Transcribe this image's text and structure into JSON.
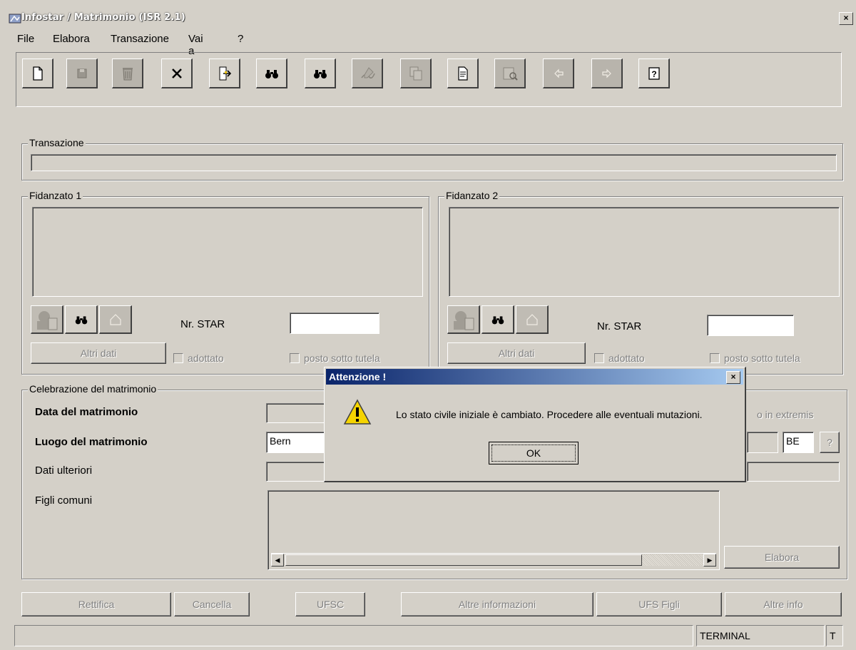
{
  "window": {
    "title": "Infostar / Matrimonio (ISR 2.1)",
    "close_glyph": "×"
  },
  "menu": [
    "File",
    "Elabora",
    "Transazione",
    "Vai a",
    "?"
  ],
  "toolbar": {
    "buttons": [
      {
        "icon": "new-document-icon",
        "enabled": true
      },
      {
        "icon": "save-icon",
        "enabled": false
      },
      {
        "icon": "trash-icon",
        "enabled": false
      },
      {
        "icon": "close-icon",
        "enabled": true
      },
      {
        "icon": "exit-door-icon",
        "enabled": true
      },
      {
        "icon": "binoculars-icon",
        "enabled": true
      },
      {
        "icon": "binoculars-icon",
        "enabled": true
      },
      {
        "icon": "sign-icon",
        "enabled": false
      },
      {
        "icon": "copy-icon",
        "enabled": false
      },
      {
        "icon": "document-icon",
        "enabled": true
      },
      {
        "icon": "preview-icon",
        "enabled": false
      },
      {
        "icon": "arrow-left-icon",
        "enabled": false
      },
      {
        "icon": "arrow-right-icon",
        "enabled": false
      },
      {
        "icon": "help-icon",
        "enabled": true
      }
    ]
  },
  "transazione": {
    "label": "Transazione",
    "value": ""
  },
  "fidanzato1": {
    "label": "Fidanzato 1",
    "nr_star_label": "Nr. STAR",
    "nr_star_value": "",
    "altri_dati": "Altri dati",
    "adottato": "adottato",
    "tutela": "posto sotto tutela"
  },
  "fidanzato2": {
    "label": "Fidanzato 2",
    "nr_star_label": "Nr. STAR",
    "nr_star_value": "",
    "altri_dati": "Altri dati",
    "adottato": "adottato",
    "tutela": "posto sotto tutela"
  },
  "celebrazione": {
    "label": "Celebrazione del matrimonio",
    "data_label": "Data del matrimonio",
    "data_value": "",
    "luogo_label": "Luogo del matrimonio",
    "luogo_value": "Bern",
    "cantone_value": "BE",
    "cantone_help": "?",
    "extremis_fragment": "o in extremis",
    "dati_ulteriori_label": "Dati ulteriori",
    "figli_label": "Figli comuni",
    "elabora_button": "Elabora"
  },
  "bottom_buttons": [
    "Rettifica",
    "Cancella",
    "UFSC",
    "Altre informazioni",
    "UFS Figli",
    "Altre info"
  ],
  "statusbar": {
    "main": "",
    "terminal": "TERMINAL",
    "flag": "T"
  },
  "dialog": {
    "title": "Attenzione !",
    "message": "Lo stato civile iniziale è cambiato. Procedere alle eventuali mutazioni.",
    "ok": "OK",
    "close_glyph": "×",
    "icon": "warning-icon"
  },
  "colors": {
    "face": "#d4d0c8",
    "dialog_title_start": "#0a246a",
    "dialog_title_end": "#a6caf0",
    "warning": "#f5d400"
  }
}
